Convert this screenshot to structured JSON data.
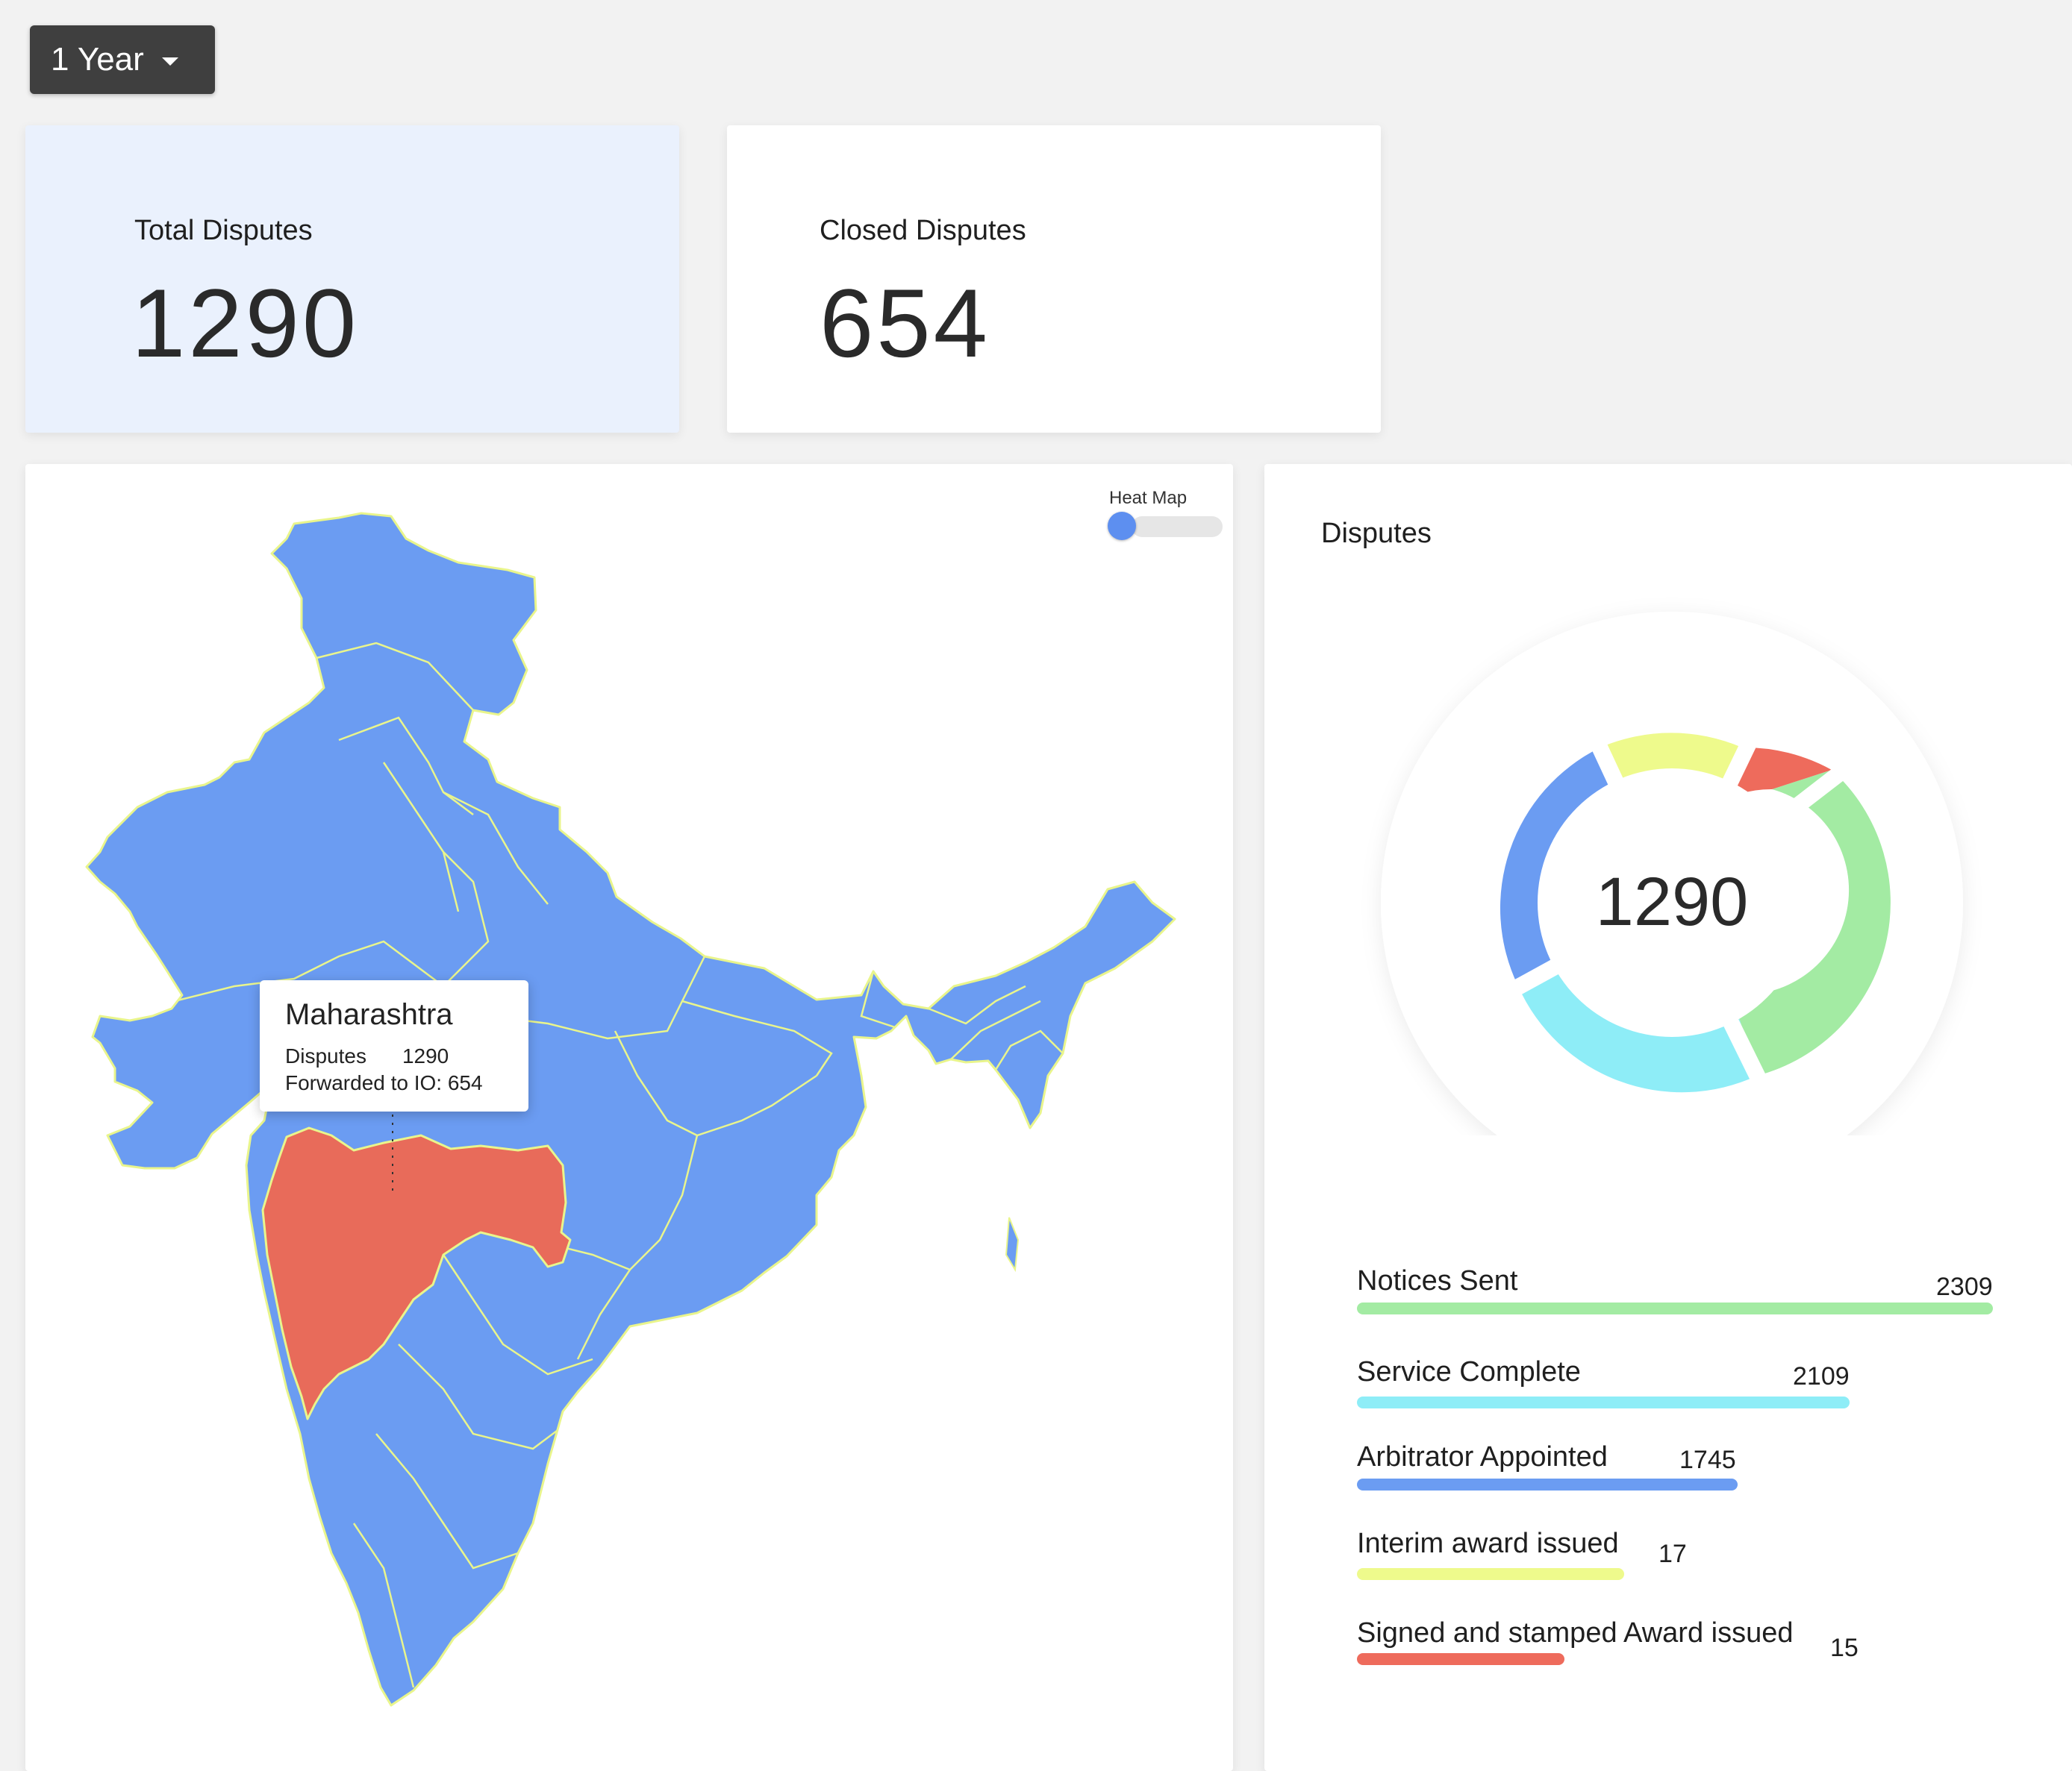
{
  "filter": {
    "period_label": "1 Year"
  },
  "stats": {
    "total": {
      "label": "Total Disputes",
      "value": "1290"
    },
    "closed": {
      "label": "Closed Disputes",
      "value": "654"
    }
  },
  "map": {
    "heat_map_label": "Heat Map",
    "heat_map_enabled": false,
    "highlight_color": "#e86b5a",
    "base_color": "#6b9cf2",
    "tooltip": {
      "state": "Maharashtra",
      "disputes_label": "Disputes",
      "disputes_value": "1290",
      "forwarded_text": "Forwarded to IO: 654"
    }
  },
  "disputes_panel": {
    "title": "Disputes",
    "center_value": "1290",
    "stages": [
      {
        "name": "Notices Sent",
        "value": 2309,
        "color": "#a3eba3"
      },
      {
        "name": "Service Complete",
        "value": 2109,
        "color": "#8eedf7"
      },
      {
        "name": "Arbitrator Appointed",
        "value": 1745,
        "color": "#6b9cf2"
      },
      {
        "name": "Interim award issued",
        "value": 17,
        "color": "#eefa8c"
      },
      {
        "name": "Signed and stamped Award issued",
        "value": 15,
        "color": "#ee6b5c"
      }
    ]
  }
}
